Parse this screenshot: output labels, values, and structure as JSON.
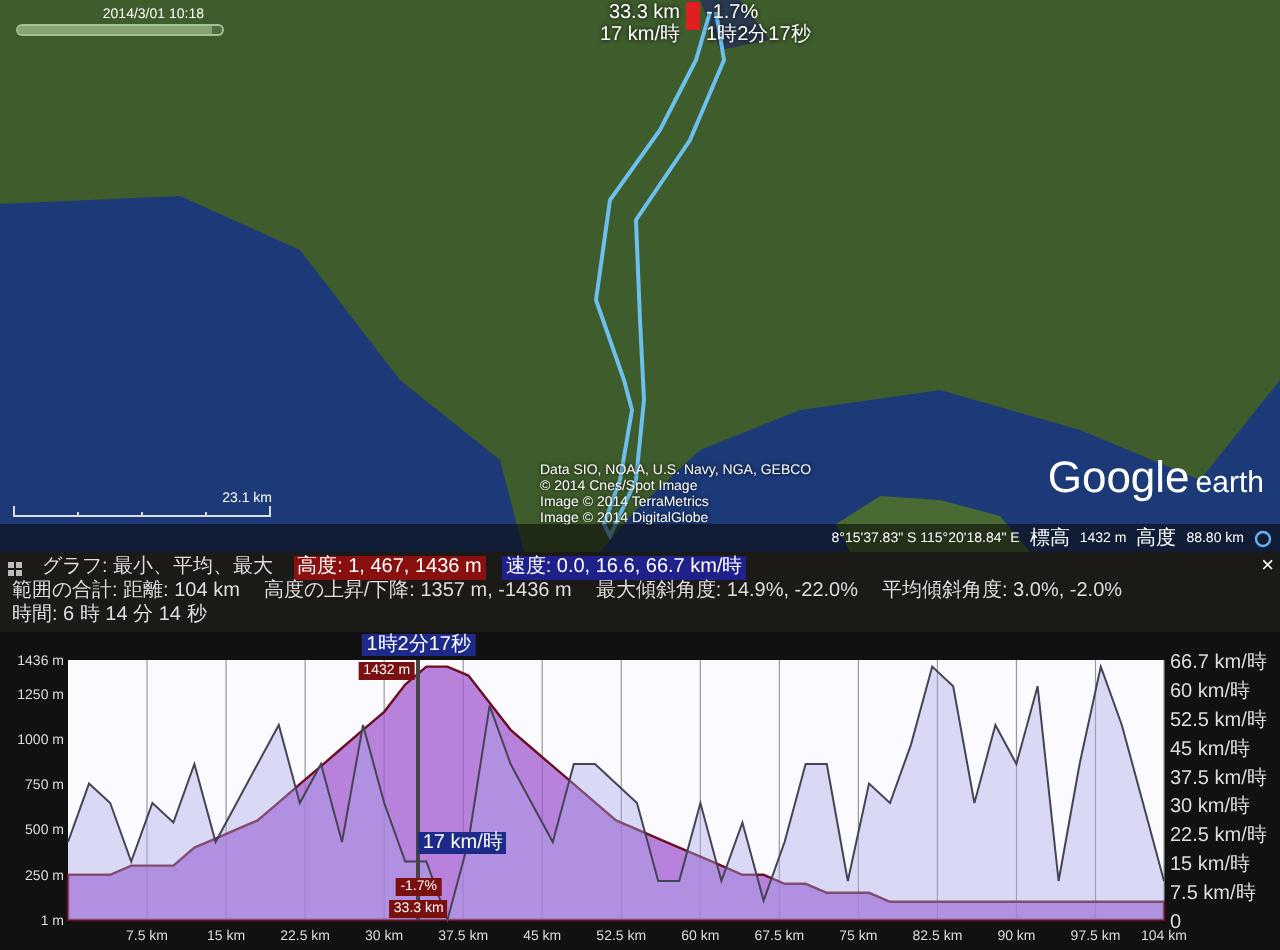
{
  "map": {
    "timeline": {
      "date": "2014/3/01 10:18",
      "level": 0.95
    },
    "cursor_marker": {
      "distance": "33.3 km",
      "grade": "-1.7%",
      "speed": "17 km/時",
      "time": "1時2分17秒"
    },
    "attribution": [
      "Data SIO, NOAA, U.S. Navy, NGA, GEBCO",
      "© 2014 Cnes/Spot Image",
      "Image © 2014 TerraMetrics",
      "Image © 2014 DigitalGlobe"
    ],
    "scale": "23.1 km",
    "logo": {
      "word_1": "Google",
      "word_2": "earth"
    },
    "status_bar": {
      "coordinates": "8°15'37.83\" S  115°20'18.84\" E",
      "elevation_label": "標高",
      "elevation": "1432 m",
      "altitude_label": "高度",
      "altitude": "88.80 km"
    }
  },
  "profile": {
    "summary": [
      {
        "text": "グラフ: 最小、平均、最大",
        "kind": "plain"
      },
      {
        "text": "高度: 1, 467, 1436 m",
        "kind": "elevation"
      },
      {
        "text": "速度: 0.0, 16.6, 66.7 km/時",
        "kind": "speed"
      }
    ],
    "totals": [
      "範囲の合計: 距離: 104 km",
      "高度の上昇/下降: 1357 m, -1436 m",
      "最大傾斜角度: 14.9%, -22.0%",
      "平均傾斜角度: 3.0%, -2.0%",
      "時間: 6 時 14 分 14 秒"
    ],
    "close": "×",
    "cursor": {
      "level": 0.32,
      "time": "1時2分17秒",
      "elevation": "1432 m",
      "speed": "17 km/時",
      "grade": "-1.7%",
      "distance": "33.3 km"
    },
    "elevation_chart": {
      "chart_data": {
        "type": "area",
        "x": [
          0,
          2,
          4,
          6,
          8,
          10,
          12,
          14,
          16,
          18,
          20,
          22,
          24,
          26,
          28,
          30,
          32,
          34,
          36,
          38,
          40,
          42,
          44,
          46,
          48,
          50,
          52,
          54,
          56,
          58,
          60,
          62,
          64,
          66,
          68,
          70,
          72,
          74,
          76,
          78,
          80,
          82,
          84,
          86,
          88,
          90,
          92,
          94,
          96,
          98,
          100,
          102,
          104
        ],
        "series": [
          {
            "color": "#6a1020",
            "values": [
              250,
              250,
              250,
              300,
              300,
              300,
              400,
              450,
              500,
              550,
              650,
              750,
              850,
              950,
              1050,
              1150,
              1300,
              1400,
              1400,
              1350,
              1200,
              1050,
              950,
              850,
              750,
              650,
              550,
              500,
              450,
              400,
              350,
              300,
              250,
              250,
              200,
              200,
              150,
              150,
              150,
              100,
              100,
              100,
              100,
              100,
              100,
              100,
              100,
              100,
              100,
              100,
              100,
              100,
              100
            ]
          }
        ],
        "xlim": [
          0,
          104
        ],
        "ylim": [
          0,
          1436
        ],
        "grid": true,
        "xticks": [
          {
            "value": 7.5,
            "label": "7.5 km"
          },
          {
            "value": 15,
            "label": "15 km"
          },
          {
            "value": 22.5,
            "label": "22.5 km"
          },
          {
            "value": 30,
            "label": "30 km"
          },
          {
            "value": 37.5,
            "label": "37.5 km"
          },
          {
            "value": 45,
            "label": "45 km"
          },
          {
            "value": 52.5,
            "label": "52.5 km"
          },
          {
            "value": 60,
            "label": "60 km"
          },
          {
            "value": 67.5,
            "label": "67.5 km"
          },
          {
            "value": 75,
            "label": "75 km"
          },
          {
            "value": 82.5,
            "label": "82.5 km"
          },
          {
            "value": 90,
            "label": "90 km"
          },
          {
            "value": 97.5,
            "label": "97.5 km"
          },
          {
            "value": 104,
            "label": "104 km"
          }
        ],
        "yticks": [
          {
            "value": 1436,
            "label": "1436 m"
          },
          {
            "value": 1250,
            "label": "1250 m"
          },
          {
            "value": 1000,
            "label": "1000 m"
          },
          {
            "value": 750,
            "label": "750 m"
          },
          {
            "value": 500,
            "label": "500 m"
          },
          {
            "value": 250,
            "label": "250 m"
          },
          {
            "value": 1,
            "label": "1 m"
          }
        ]
      }
    },
    "speed_axis": [
      "66.7 km/時",
      "60 km/時",
      "52.5 km/時",
      "45 km/時",
      "37.5 km/時",
      "30 km/時",
      "22.5 km/時",
      "15 km/時",
      "7.5 km/時",
      "0"
    ]
  }
}
